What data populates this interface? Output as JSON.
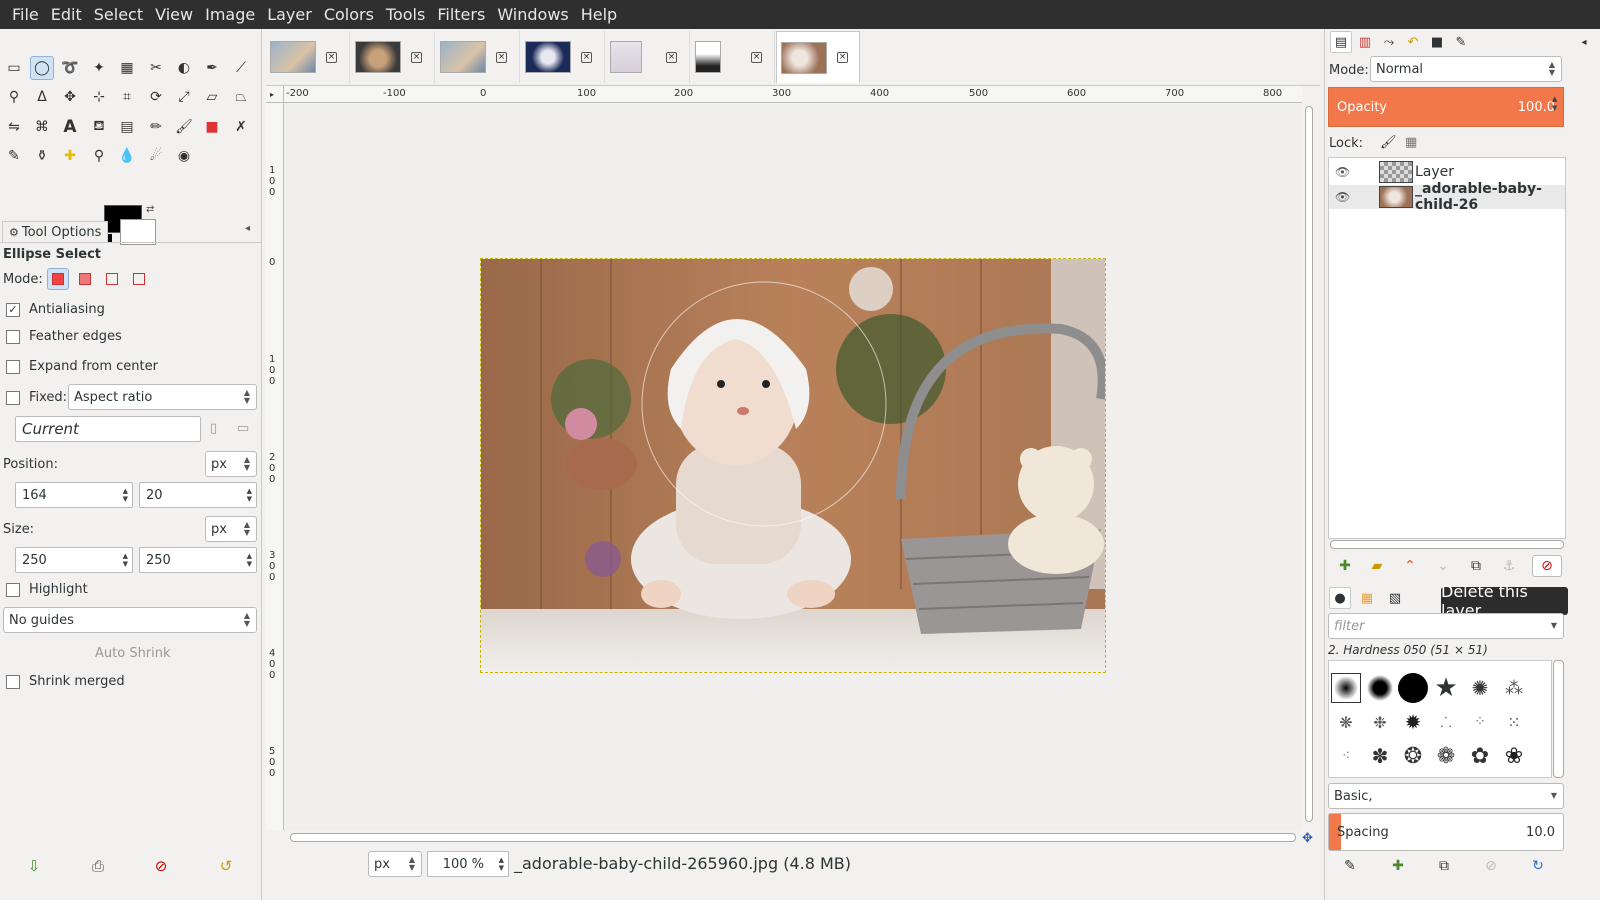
{
  "menu": [
    "File",
    "Edit",
    "Select",
    "View",
    "Image",
    "Layer",
    "Colors",
    "Tools",
    "Filters",
    "Windows",
    "Help"
  ],
  "tool_options": {
    "tab_label": "Tool Options",
    "title": "Ellipse Select",
    "mode_label": "Mode:",
    "antialiasing": "Antialiasing",
    "feather_edges": "Feather edges",
    "expand_from_center": "Expand from center",
    "fixed_label": "Fixed:",
    "fixed_value": "Aspect ratio",
    "current_value": "Current",
    "position_label": "Position:",
    "position_unit": "px",
    "position_x": "164",
    "position_y": "20",
    "size_label": "Size:",
    "size_unit": "px",
    "size_w": "250",
    "size_h": "250",
    "highlight": "Highlight",
    "guides_value": "No guides",
    "auto_shrink": "Auto Shrink",
    "shrink_merged": "Shrink merged"
  },
  "rulers": {
    "h_ticks": [
      "-200",
      "-100",
      "0",
      "100",
      "200",
      "300",
      "400",
      "500",
      "600",
      "700",
      "800"
    ],
    "v_ticks": [
      "100",
      "0",
      "100",
      "200",
      "300",
      "400",
      "500"
    ]
  },
  "status": {
    "unit": "px",
    "zoom": "100 %",
    "filename": "_adorable-baby-child-265960.jpg (4.8 MB)"
  },
  "layers": {
    "mode_label": "Mode:",
    "mode_value": "Normal",
    "opacity_label": "Opacity",
    "opacity_value": "100.0",
    "lock_label": "Lock:",
    "items": [
      {
        "name": "Layer"
      },
      {
        "name": "_adorable-baby-child-26"
      }
    ]
  },
  "tooltip": "Delete this layer",
  "brushes": {
    "filter_placeholder": "filter",
    "selected_brush": "2. Hardness 050 (51 × 51)",
    "tag_value": "Basic,",
    "spacing_label": "Spacing",
    "spacing_value": "10.0"
  }
}
